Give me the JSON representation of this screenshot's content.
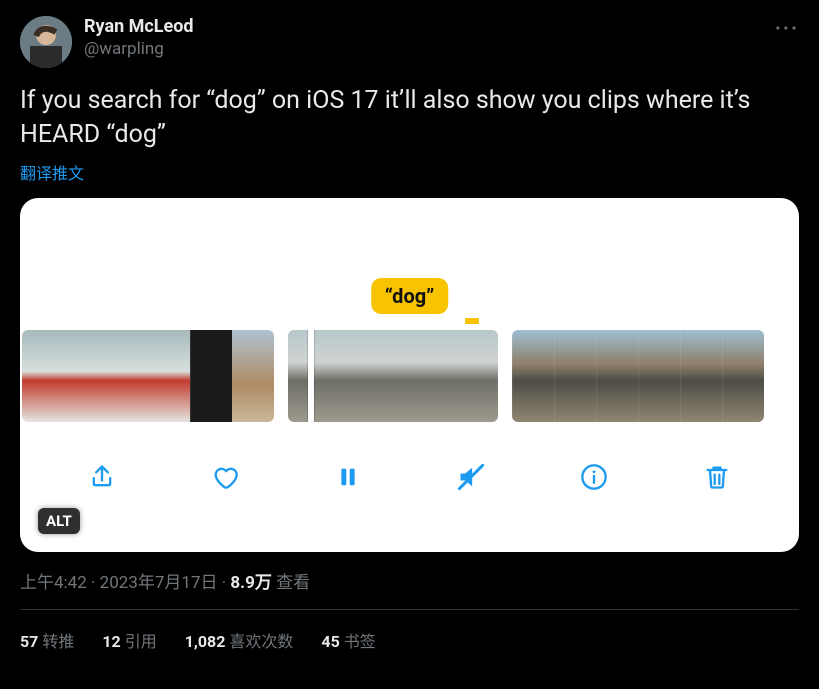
{
  "author": {
    "display_name": "Ryan McLeod",
    "handle": "@warpling"
  },
  "body": "If you search for “dog” on iOS 17 it’ll also show you clips where it’s HEARD “dog”",
  "translate_label": "翻译推文",
  "media": {
    "search_tag": "“dog”",
    "alt_badge": "ALT",
    "toolbar": {
      "share": "share",
      "like": "like",
      "pause": "pause",
      "mute": "mute",
      "info": "info",
      "delete": "delete"
    }
  },
  "meta": {
    "time": "上午4:42",
    "date": "2023年7月17日",
    "views_count": "8.9万",
    "views_label": " 查看",
    "separator": " · "
  },
  "engagement": {
    "retweets": {
      "count": "57",
      "label": "转推"
    },
    "quotes": {
      "count": "12",
      "label": "引用"
    },
    "likes": {
      "count": "1,082",
      "label": "喜欢次数"
    },
    "bookmarks": {
      "count": "45",
      "label": "书签"
    }
  }
}
